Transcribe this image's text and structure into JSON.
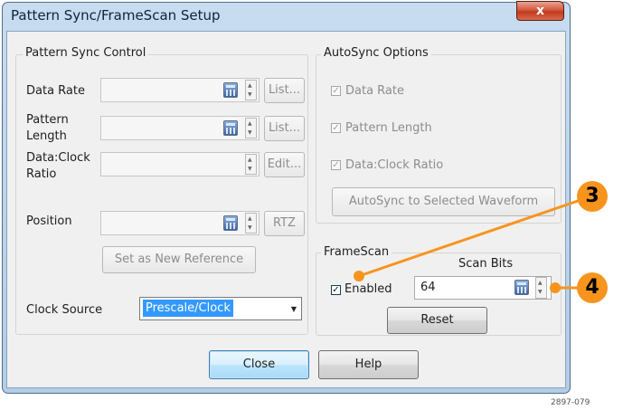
{
  "window": {
    "title": "Pattern Sync/FrameScan Setup",
    "close_glyph": "x"
  },
  "pattern_sync": {
    "legend": "Pattern Sync Control",
    "data_rate_label": "Data Rate",
    "data_rate_button": "List...",
    "pattern_length_label_1": "Pattern",
    "pattern_length_label_2": "Length",
    "pattern_length_button": "List...",
    "data_clock_label_1": "Data:Clock",
    "data_clock_label_2": "Ratio",
    "data_clock_button": "Edit...",
    "position_label": "Position",
    "position_button": "RTZ",
    "set_reference_button": "Set as New Reference",
    "clock_source_label": "Clock Source",
    "clock_source_value": "Prescale/Clock"
  },
  "autosync": {
    "legend": "AutoSync Options",
    "data_rate": "Data Rate",
    "pattern_length": "Pattern Length",
    "data_clock_ratio": "Data:Clock Ratio",
    "autosync_button": "AutoSync to Selected Waveform",
    "checked": [
      true,
      true,
      true
    ]
  },
  "framescan": {
    "legend": "FrameScan",
    "scan_bits_label": "Scan Bits",
    "enabled_label": "Enabled",
    "enabled": true,
    "scan_bits_value": "64",
    "reset_button": "Reset"
  },
  "footer": {
    "close_button": "Close",
    "help_button": "Help"
  },
  "callouts": {
    "first": "3",
    "second": "4",
    "accent_color": "#f7941d"
  },
  "figure_ref": "2897-079"
}
